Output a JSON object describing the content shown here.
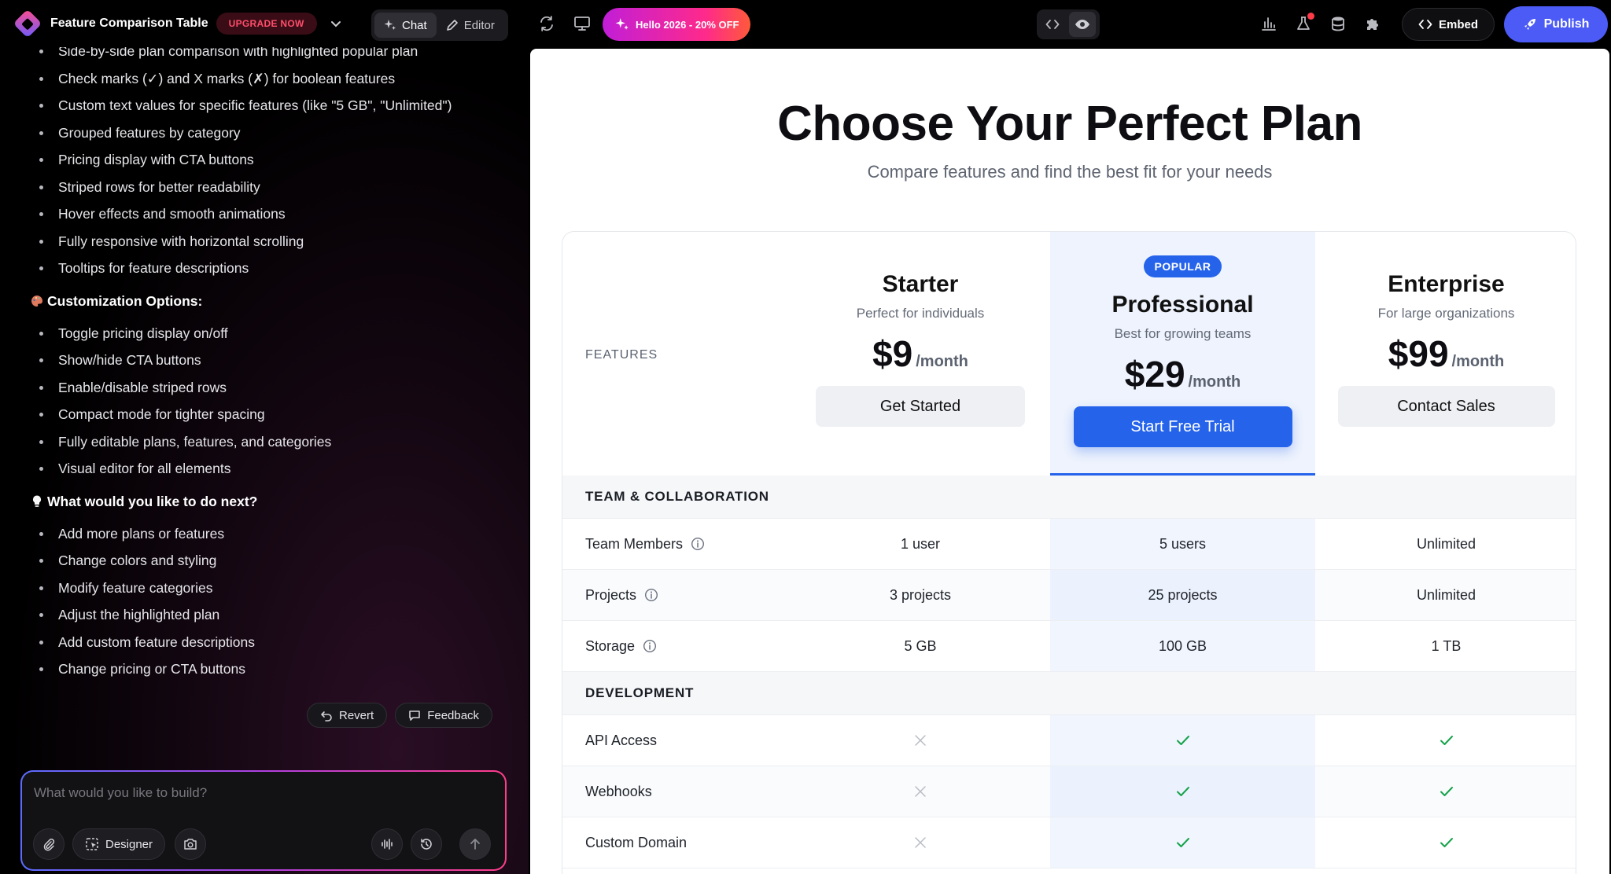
{
  "app": {
    "project_title": "Feature Comparison Table",
    "upgrade_label": "UPGRADE NOW",
    "mode_tabs": {
      "chat": "Chat",
      "editor": "Editor"
    },
    "promo_label": "Hello 2026 - 20% OFF",
    "embed_label": "Embed",
    "publish_label": "Publish"
  },
  "chat": {
    "features_list": [
      "Side-by-side plan comparison with highlighted popular plan",
      "Check marks (✓) and X marks (✗) for boolean features",
      "Custom text values for specific features (like \"5 GB\", \"Unlimited\")",
      "Grouped features by category",
      "Pricing display with CTA buttons",
      "Striped rows for better readability",
      "Hover effects and smooth animations",
      "Fully responsive with horizontal scrolling",
      "Tooltips for feature descriptions"
    ],
    "customization_heading": "Customization Options:",
    "customization_list": [
      "Toggle pricing display on/off",
      "Show/hide CTA buttons",
      "Enable/disable striped rows",
      "Compact mode for tighter spacing",
      "Fully editable plans, features, and categories",
      "Visual editor for all elements"
    ],
    "next_heading": "What would you like to do next?",
    "next_list": [
      "Add more plans or features",
      "Change colors and styling",
      "Modify feature categories",
      "Adjust the highlighted plan",
      "Add custom feature descriptions",
      "Change pricing or CTA buttons"
    ],
    "revert_label": "Revert",
    "feedback_label": "Feedback",
    "prompt_placeholder": "What would you like to build?",
    "designer_label": "Designer"
  },
  "preview": {
    "title": "Choose Your Perfect Plan",
    "subtitle": "Compare features and find the best fit for your needs",
    "features_label": "FEATURES",
    "plans": [
      {
        "name": "Starter",
        "desc": "Perfect for individuals",
        "price": "$9",
        "period": "/month",
        "cta": "Get Started",
        "popular": false
      },
      {
        "name": "Professional",
        "desc": "Best for growing teams",
        "price": "$29",
        "period": "/month",
        "cta": "Start Free Trial",
        "popular": true,
        "badge": "POPULAR"
      },
      {
        "name": "Enterprise",
        "desc": "For large organizations",
        "price": "$99",
        "period": "/month",
        "cta": "Contact Sales",
        "popular": false
      }
    ],
    "categories": [
      {
        "name": "TEAM & COLLABORATION",
        "features": [
          {
            "name": "Team Members",
            "info": true,
            "values": [
              "1 user",
              "5 users",
              "Unlimited"
            ]
          },
          {
            "name": "Projects",
            "info": true,
            "values": [
              "3 projects",
              "25 projects",
              "Unlimited"
            ]
          },
          {
            "name": "Storage",
            "info": true,
            "values": [
              "5 GB",
              "100 GB",
              "1 TB"
            ]
          }
        ]
      },
      {
        "name": "DEVELOPMENT",
        "features": [
          {
            "name": "API Access",
            "info": false,
            "values": [
              false,
              true,
              true
            ]
          },
          {
            "name": "Webhooks",
            "info": false,
            "values": [
              false,
              true,
              true
            ]
          },
          {
            "name": "Custom Domain",
            "info": false,
            "values": [
              false,
              true,
              true
            ]
          }
        ]
      }
    ],
    "colors": {
      "accent": "#2563eb",
      "check": "#16a34a",
      "cross": "#b8bcc4"
    }
  }
}
